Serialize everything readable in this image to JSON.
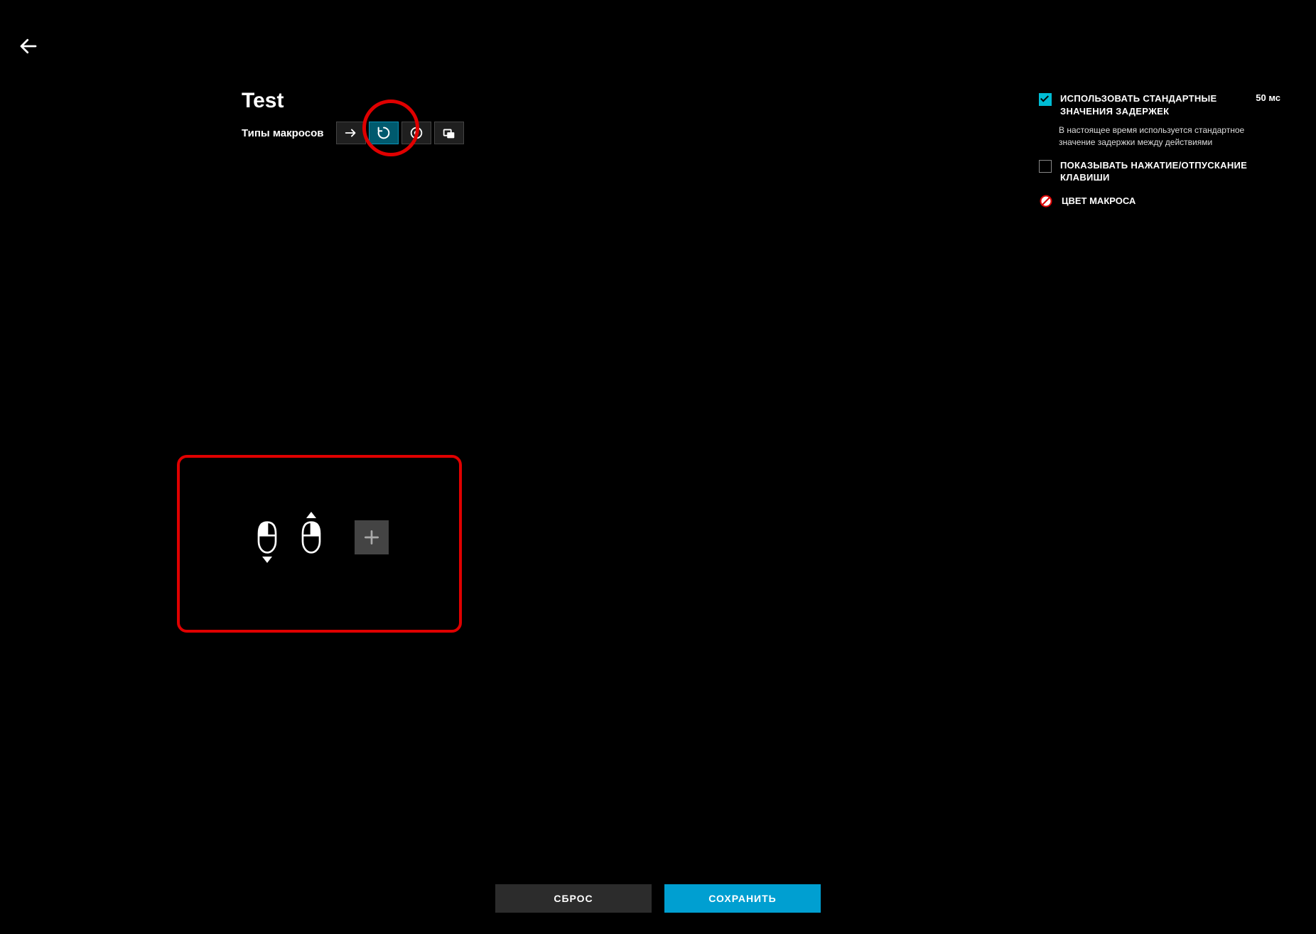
{
  "title": "Test",
  "types_label": "Типы макросов",
  "settings": {
    "use_default_delay": {
      "label": "ИСПОЛЬЗОВАТЬ СТАНДАРТНЫЕ ЗНАЧЕНИЯ ЗАДЕРЖЕК",
      "value": "50 мс",
      "desc": "В настоящее время используется стандартное значение задержки между действиями",
      "checked": true
    },
    "show_press_release": {
      "label": "ПОКАЗЫВАТЬ НАЖАТИЕ/ОТПУСКАНИЕ КЛАВИШИ",
      "checked": false
    },
    "macro_color_label": "ЦВЕТ МАКРОСА"
  },
  "macro_type_icons": [
    "arrow-right-icon",
    "loop-icon",
    "record-icon",
    "overlay-icon"
  ],
  "macro_type_active_index": 1,
  "action_icons": [
    "mouse-left-icon",
    "mouse-right-icon"
  ],
  "buttons": {
    "reset": "СБРОС",
    "save": "СОХРАНИТЬ"
  }
}
